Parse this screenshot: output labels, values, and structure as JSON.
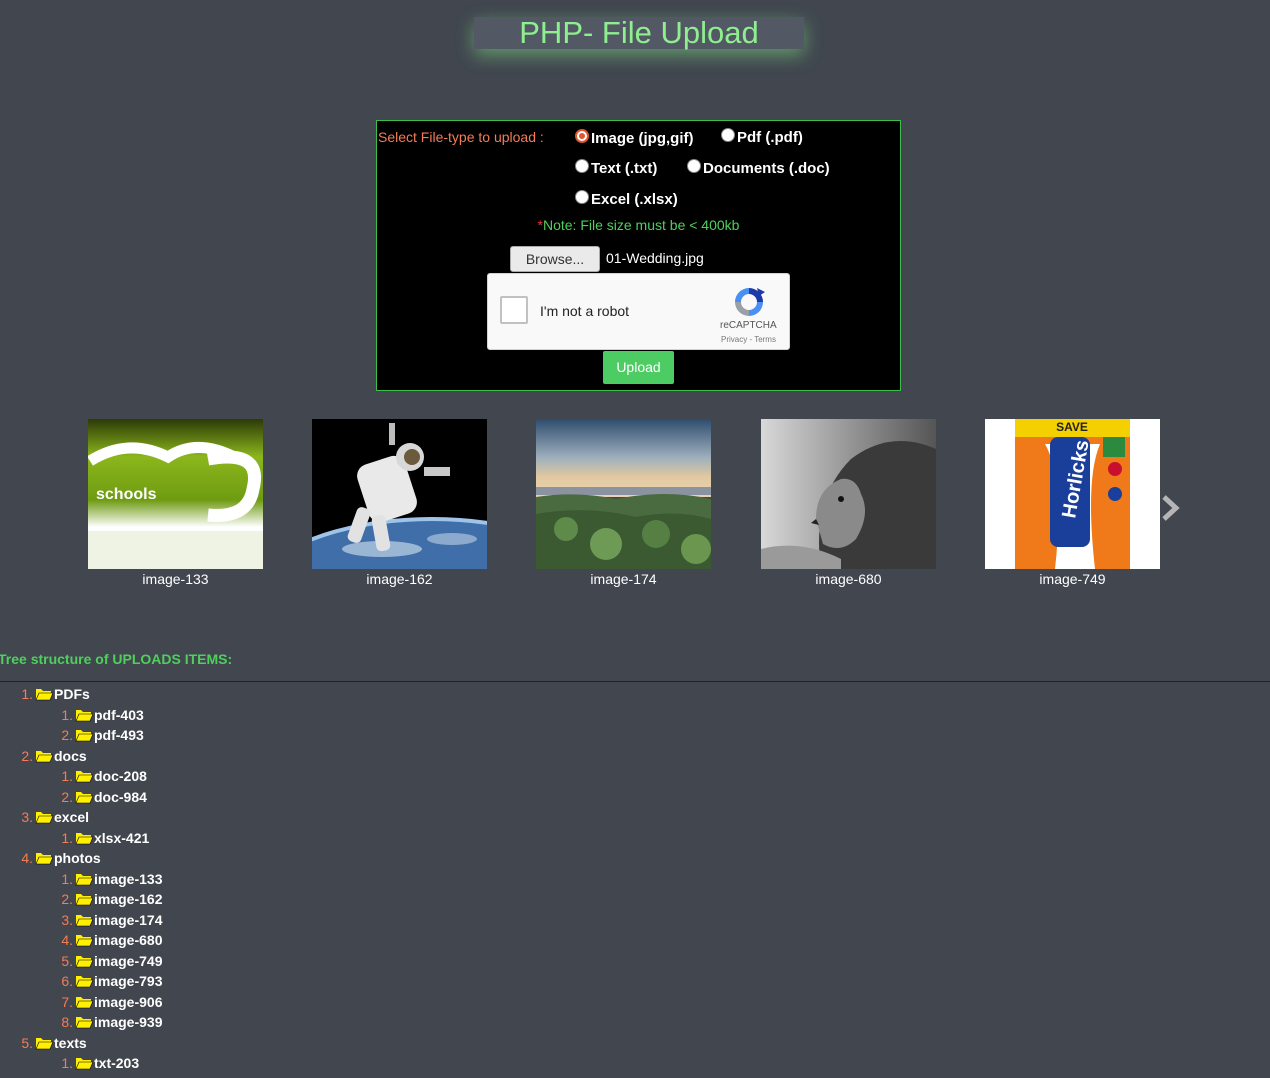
{
  "page": {
    "title": "PHP- File Upload"
  },
  "form": {
    "select_label": "Select File-type to upload :",
    "radios": [
      {
        "label": "Image (jpg,gif)",
        "checked": true
      },
      {
        "label": "Pdf (.pdf)",
        "checked": false
      },
      {
        "label": "Text (.txt)",
        "checked": false
      },
      {
        "label": "Documents (.doc)",
        "checked": false
      },
      {
        "label": "Excel (.xlsx)",
        "checked": false
      }
    ],
    "note_star": "*",
    "note_text": "Note: File size must be < 400kb",
    "browse_label": "Browse...",
    "file_name": "01-Wedding.jpg",
    "captcha": {
      "label": "I'm not a robot",
      "brand": "reCAPTCHA",
      "terms": "Privacy - Terms"
    },
    "upload_label": "Upload"
  },
  "gallery": {
    "items": [
      {
        "caption": "image-133",
        "thumb_text": "schools"
      },
      {
        "caption": "image-162"
      },
      {
        "caption": "image-174"
      },
      {
        "caption": "image-680"
      },
      {
        "caption": "image-749",
        "thumb_text": "SAVE",
        "brand_text": "Horlicks"
      }
    ]
  },
  "tree": {
    "title": "Tree structure of UPLOADS ITEMS:",
    "folders": [
      {
        "num": "1.",
        "name": "PDFs",
        "children": [
          {
            "num": "1.",
            "name": "pdf-403"
          },
          {
            "num": "2.",
            "name": "pdf-493"
          }
        ]
      },
      {
        "num": "2.",
        "name": "docs",
        "children": [
          {
            "num": "1.",
            "name": "doc-208"
          },
          {
            "num": "2.",
            "name": "doc-984"
          }
        ]
      },
      {
        "num": "3.",
        "name": "excel",
        "children": [
          {
            "num": "1.",
            "name": "xlsx-421"
          }
        ]
      },
      {
        "num": "4.",
        "name": "photos",
        "children": [
          {
            "num": "1.",
            "name": "image-133"
          },
          {
            "num": "2.",
            "name": "image-162"
          },
          {
            "num": "3.",
            "name": "image-174"
          },
          {
            "num": "4.",
            "name": "image-680"
          },
          {
            "num": "5.",
            "name": "image-749"
          },
          {
            "num": "6.",
            "name": "image-793"
          },
          {
            "num": "7.",
            "name": "image-906"
          },
          {
            "num": "8.",
            "name": "image-939"
          }
        ]
      },
      {
        "num": "5.",
        "name": "texts",
        "children": [
          {
            "num": "1.",
            "name": "txt-203"
          }
        ]
      }
    ]
  },
  "colors": {
    "background": "#41464f",
    "title": "#8fef8f",
    "accent_green": "#4ed05c",
    "label_orange": "#f47c56",
    "folder_yellow": "#ffef00"
  }
}
